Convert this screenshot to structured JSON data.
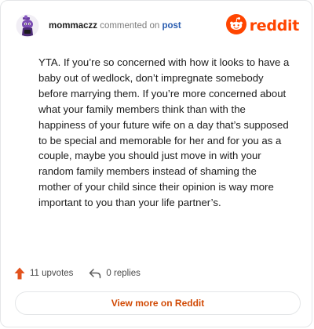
{
  "header": {
    "username": "mommaczz",
    "action_text": "commented on",
    "post_link": "post",
    "avatar_icon": "snoo-avatar-icon",
    "brand": {
      "wordmark": "reddit",
      "logo_icon": "reddit-snoo-logo-icon",
      "color": "#ff4500"
    }
  },
  "comment": {
    "body": "YTA. If you’re so concerned with how it looks to have a baby out of wedlock, don’t impregnate somebody before marrying them. If you’re more concerned about what your family members think than with the happiness of your future wife on a day that’s supposed to be special and memorable for her and for you as a couple, maybe you should just move in with your random family members instead of shaming the mother of your child since their opinion is way more important to you than your life partner’s."
  },
  "footer": {
    "upvotes_label": "11 upvotes",
    "upvote_icon": "upvote-arrow-icon",
    "upvote_color": "#e2521d",
    "replies_label": "0 replies",
    "reply_icon": "reply-arrow-icon"
  },
  "actions": {
    "view_more_label": "View more on Reddit",
    "view_more_color": "#d14a05"
  }
}
